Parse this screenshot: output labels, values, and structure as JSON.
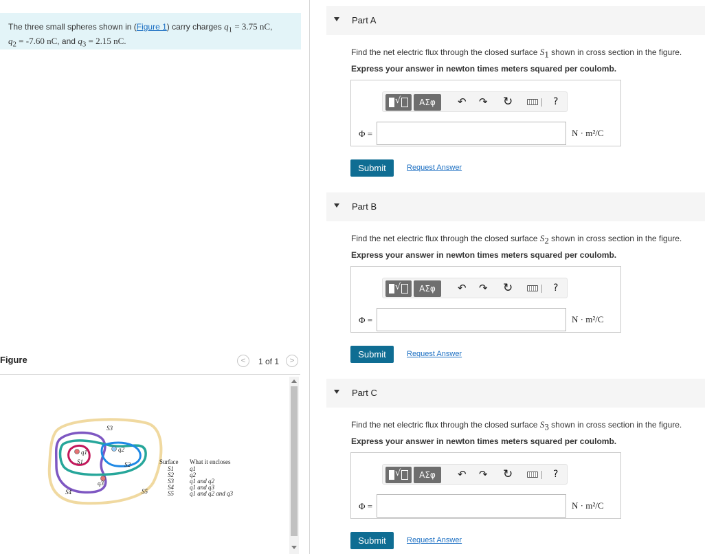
{
  "problem": {
    "text_before": "The three small spheres shown in (",
    "figure_link": "Figure 1",
    "text_after": ") carry charges",
    "q1_name": "q",
    "q1_sub": "1",
    "q1_value": " = 3.75 ",
    "q1_unit": "nC",
    "q2_name": "q",
    "q2_sub": "2",
    "q2_value": " = -7.60 ",
    "q2_unit": "nC",
    "and_text": ", and",
    "q3_name": "q",
    "q3_sub": "3",
    "q3_value": " = 2.15 ",
    "q3_unit": "nC",
    "end": "."
  },
  "figure": {
    "title": "Figure",
    "pager_prev": "<",
    "pager_text": "1 of 1",
    "pager_next": ">",
    "surface_labels": [
      "S1",
      "S2",
      "S3",
      "S4",
      "S5"
    ],
    "charge_labels": [
      "q1",
      "q2",
      "q3"
    ],
    "table_header_surface": "Surface",
    "table_header_encloses": "What it encloses",
    "table_rows": [
      {
        "s": "S1",
        "e": "q1"
      },
      {
        "s": "S2",
        "e": "q2"
      },
      {
        "s": "S3",
        "e": "q1 and q2"
      },
      {
        "s": "S4",
        "e": "q1 and q3"
      },
      {
        "s": "S5",
        "e": "q1 and q2 and q3"
      }
    ],
    "colors": {
      "S1": "#c2185b",
      "S2": "#1e88e5",
      "S3": "#26a69a",
      "S4": "#7e57c2",
      "S5": "#f0d9a0",
      "q1": "#e57373",
      "q2": "#90caf9",
      "q3": "#e57373"
    }
  },
  "toolbar": {
    "greek": "ΑΣφ",
    "undo_icon": "undo-icon",
    "redo_icon": "redo-icon",
    "reset_icon": "reset-icon",
    "keyboard_icon": "keyboard-icon",
    "help": "?"
  },
  "parts": [
    {
      "title": "Part A",
      "question_before": "Find the net electric flux through the closed surface ",
      "surface": "S",
      "surface_sub": "1",
      "question_after": " shown in cross section in the figure.",
      "instruction": "Express your answer in newton times meters squared per coulomb.",
      "phi_label": "Φ =",
      "input_value": "",
      "unit": "N · m²/C",
      "submit": "Submit",
      "request": "Request Answer"
    },
    {
      "title": "Part B",
      "question_before": "Find the net electric flux through the closed surface ",
      "surface": "S",
      "surface_sub": "2",
      "question_after": " shown in cross section in the figure.",
      "instruction": "Express your answer in newton times meters squared per coulomb.",
      "phi_label": "Φ =",
      "input_value": "",
      "unit": "N · m²/C",
      "submit": "Submit",
      "request": "Request Answer"
    },
    {
      "title": "Part C",
      "question_before": "Find the net electric flux through the closed surface ",
      "surface": "S",
      "surface_sub": "3",
      "question_after": " shown in cross section in the figure.",
      "instruction": "Express your answer in newton times meters squared per coulomb.",
      "phi_label": "Φ =",
      "input_value": "",
      "unit": "N · m²/C",
      "submit": "Submit",
      "request": "Request Answer"
    }
  ]
}
